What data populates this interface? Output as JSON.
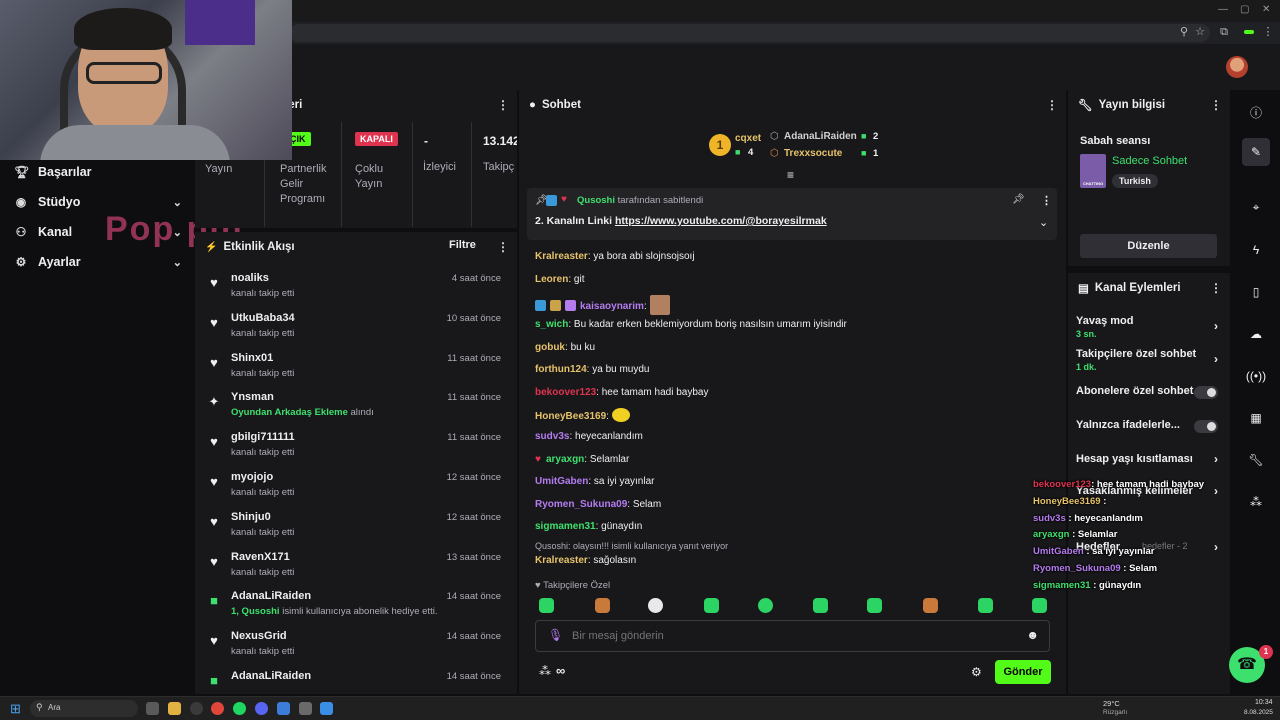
{
  "app": {
    "colors": {
      "bg": "#0e0e10",
      "panel": "#18181b",
      "accent_green": "#3ee06d",
      "button_green": "#53fc18"
    }
  },
  "leftnav": {
    "items": [
      {
        "label": "Başarılar",
        "icon": "trophy-icon"
      },
      {
        "label": "Stüdyo",
        "icon": "studio-icon"
      },
      {
        "label": "Kanal",
        "icon": "channel-icon"
      },
      {
        "label": "Ayarlar",
        "icon": "gear-icon"
      }
    ],
    "watermark": "Pop pin"
  },
  "stats": {
    "title_fragment": "leri",
    "items": [
      {
        "badge": "ÇIK",
        "label": "Yayın"
      },
      {
        "badge": "",
        "label": "Partnerlik Gelir Programı"
      },
      {
        "badge": "KAPALI",
        "label": "Çoklu Yayın"
      },
      {
        "value": "-",
        "label": "İzleyici"
      },
      {
        "value": "13.142",
        "label": "Takipç"
      }
    ]
  },
  "activity": {
    "title": "Etkinlik Akışı",
    "filter_label": "Filtre",
    "items": [
      {
        "name": "noaliks",
        "sub": "kanalı takip etti",
        "time": "4 saat önce",
        "icon": "heart-icon"
      },
      {
        "name": "UtkuBaba34",
        "sub": "kanalı takip etti",
        "time": "10 saat önce",
        "icon": "heart-icon"
      },
      {
        "name": "Shinx01",
        "sub": "kanalı takip etti",
        "time": "11 saat önce",
        "icon": "heart-icon"
      },
      {
        "name": "Ynsman",
        "sub_hl": "Oyundan Arkadaş Ekleme",
        "sub": " alındı",
        "time": "11 saat önce",
        "icon": "reward-icon"
      },
      {
        "name": "gbilgi711111",
        "sub": "kanalı takip etti",
        "time": "11 saat önce",
        "icon": "heart-icon"
      },
      {
        "name": "myojojo",
        "sub": "kanalı takip etti",
        "time": "12 saat önce",
        "icon": "heart-icon"
      },
      {
        "name": "Shinju0",
        "sub": "kanalı takip etti",
        "time": "12 saat önce",
        "icon": "heart-icon"
      },
      {
        "name": "RavenX171",
        "sub": "kanalı takip etti",
        "time": "13 saat önce",
        "icon": "heart-icon"
      },
      {
        "name": "AdanaLiRaiden",
        "sub_hl": "1, Qusoshi",
        "sub": " isimli kullanıcıya abonelik hediye etti.",
        "time": "14 saat önce",
        "icon": "gift-icon"
      },
      {
        "name": "NexusGrid",
        "sub": "kanalı takip etti",
        "time": "14 saat önce",
        "icon": "heart-icon"
      },
      {
        "name": "AdanaLiRaiden",
        "sub": "",
        "time": "14 saat önce",
        "icon": "gift-icon"
      }
    ]
  },
  "chat": {
    "title": "Sohbet",
    "leaderboard": [
      {
        "name": "cqxet",
        "count": "4"
      },
      {
        "name": "AdanaLiRaiden",
        "count": "2"
      },
      {
        "name": "Trexxsocute",
        "count": "1"
      }
    ],
    "pinned": {
      "by_user": "Qusoshi",
      "by_suffix": "tarafından sabitlendi",
      "text_prefix": "2. Kanalın Linki ",
      "link": "https://www.youtube.com/@borayesilrmak"
    },
    "messages": [
      {
        "user": "Kralreaster",
        "color": "#e6c36a",
        "text": "ya bora abi slojnsojsoıj"
      },
      {
        "user": "Leoren",
        "color": "#e6c36a",
        "text": "git"
      },
      {
        "user": "kaisaoynarim",
        "color": "#b57cf0",
        "text": ""
      },
      {
        "user": "s_wich",
        "color": "#3ee06d",
        "text": "Bu kadar erken beklemiyordum boriş nasılsın umarım iyisindir"
      },
      {
        "user": "gobuk",
        "color": "#e6c36a",
        "text": "bu ku"
      },
      {
        "user": "forthun124",
        "color": "#e6c36a",
        "text": "ya bu muydu"
      },
      {
        "user": "bekoover123",
        "color": "#e0334f",
        "text": "hee tamam hadi baybay"
      },
      {
        "user": "HoneyBee3169",
        "color": "#e6c36a",
        "text": ""
      },
      {
        "user": "sudv3s",
        "color": "#b57cf0",
        "text": "heyecanlandım"
      },
      {
        "user": "aryaxgn",
        "color": "#3ee06d",
        "text": "Selamlar"
      },
      {
        "user": "UmitGaben",
        "color": "#b57cf0",
        "text": "sa iyi yayınlar"
      },
      {
        "user": "Ryomen_Sukuna09",
        "color": "#b57cf0",
        "text": "Selam"
      },
      {
        "user": "sigmamen31",
        "color": "#3ee06d",
        "text": "günaydın"
      }
    ],
    "reply_note": "Qusoshi: olaysın!!! isimli kullanıcıya yanıt veriyor",
    "reply": {
      "user": "Kralreaster",
      "text": "sağolasın"
    },
    "follower_only": "Takipçilere Özel",
    "input_placeholder": "Bir mesaj gönderin",
    "send_label": "Gönder",
    "infinity": "∞"
  },
  "stream_info": {
    "title": "Yayın bilgisi",
    "stream_title": "Sabah seansı",
    "category": "Sadece Sohbet",
    "category_thumb": "CHATTING",
    "language": "Turkish",
    "edit_label": "Düzenle"
  },
  "channel_actions": {
    "title": "Kanal Eylemleri",
    "items": [
      {
        "label": "Yavaş mod",
        "sub": "3 sn.",
        "kind": "chevron"
      },
      {
        "label": "Takipçilere özel sohbet",
        "sub": "1 dk.",
        "kind": "chevron"
      },
      {
        "label": "Abonelere özel sohbet",
        "sub": "",
        "kind": "toggle"
      },
      {
        "label": "Yalnızca ifadelerle...",
        "sub": "",
        "kind": "toggle"
      },
      {
        "label": "Hesap yaşı kısıtlaması",
        "sub": "",
        "kind": "chevron"
      },
      {
        "label": "Yasaklanmış kelimeler",
        "sub": "",
        "kind": "chevron"
      },
      {
        "label": "Hedefler",
        "sub": "",
        "kind": "chevron",
        "extra": "hedefler - 2"
      }
    ]
  },
  "overlay_chat": [
    {
      "user": "bekoover123",
      "color": "#e0334f",
      "text": ": hee tamam hadi baybay"
    },
    {
      "user": "HoneyBee3169",
      "color": "#e6c36a",
      "text": " :"
    },
    {
      "user": "sudv3s",
      "color": "#b57cf0",
      "text": " : heyecanlandım"
    },
    {
      "user": "aryaxgn",
      "color": "#3ee06d",
      "text": " : Selamlar"
    },
    {
      "user": "UmitGaben",
      "color": "#b57cf0",
      "text": " : sa iyi yayınlar"
    },
    {
      "user": "Ryomen_Sukuna09",
      "color": "#b57cf0",
      "text": " : Selam"
    },
    {
      "user": "sigmamen31",
      "color": "#3ee06d",
      "text": " : günaydın"
    }
  ],
  "taskbar": {
    "search": "Ara",
    "weather": "29°C",
    "weather_sub": "Rüzgarlı",
    "time": "10:34",
    "date": "8.08.2025"
  },
  "notification_badge": "1"
}
